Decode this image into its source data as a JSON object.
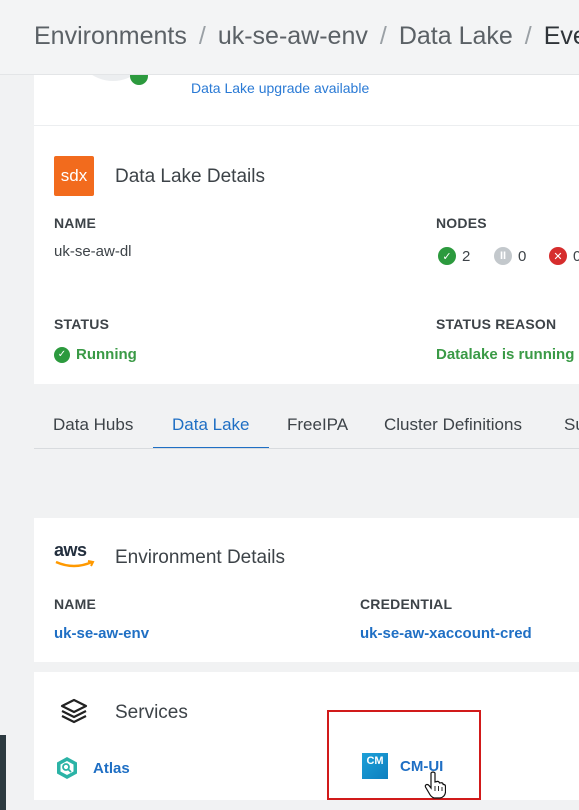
{
  "breadcrumb": {
    "items": [
      "Environments",
      "uk-se-aw-env",
      "Data Lake",
      "Even"
    ],
    "separator": "/"
  },
  "top": {
    "upgrade_link": "Data Lake upgrade available"
  },
  "data_lake_details": {
    "logo_text": "sdx",
    "title": "Data Lake Details",
    "name_label": "NAME",
    "name_value": "uk-se-aw-dl",
    "nodes_label": "NODES",
    "nodes": {
      "healthy": "2",
      "stopped": "0",
      "failed": "0"
    },
    "status_label": "STATUS",
    "status_value": "Running",
    "status_reason_label": "STATUS REASON",
    "status_reason_value": "Datalake is running"
  },
  "tabs": [
    {
      "label": "Data Hubs"
    },
    {
      "label": "Data Lake",
      "active": true
    },
    {
      "label": "FreeIPA"
    },
    {
      "label": "Cluster Definitions"
    },
    {
      "label": "Su"
    }
  ],
  "environment_details": {
    "logo_text": "aws",
    "title": "Environment Details",
    "name_label": "NAME",
    "name_value": "uk-se-aw-env",
    "credential_label": "CREDENTIAL",
    "credential_value": "uk-se-aw-xaccount-cred"
  },
  "services": {
    "title": "Services",
    "items": [
      {
        "label": "Atlas",
        "icon": "atlas-icon"
      },
      {
        "label": "CM-UI",
        "icon": "cloudera-manager-icon",
        "icon_text": "CM"
      }
    ]
  },
  "colors": {
    "link": "#1f6fc4",
    "success": "#2c9a3e",
    "error": "#d62d2d",
    "sdx_orange": "#f26b1d",
    "highlight": "#d11a1a"
  }
}
